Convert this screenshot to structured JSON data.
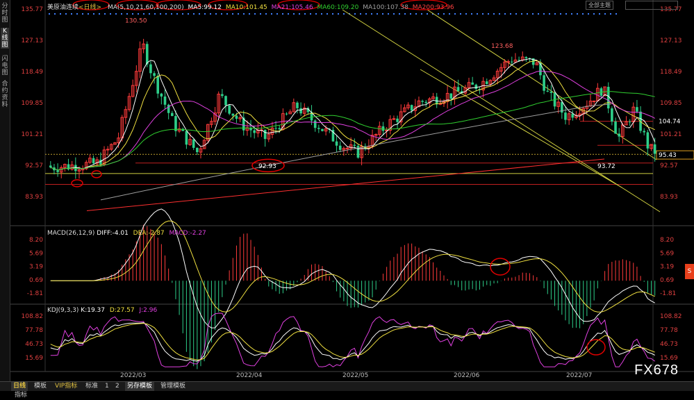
{
  "sidebar": {
    "tabs": [
      "分时图",
      "K线图",
      "闪电图",
      "合约资料"
    ],
    "active": 1
  },
  "main_chart": {
    "legend": {
      "symbol": "美原油连续",
      "period": "<日线>",
      "ma_params": "MA(5,10,21,60,100,200)",
      "ma5": "MA5:99.12",
      "ma10": "MA10:101.45",
      "ma21": "MA21:105.46",
      "ma60": "MA60:109.20",
      "ma100": "MA100:107.38",
      "ma200": "MA200:93.96"
    },
    "y_ticks": [
      "135.77",
      "127.13",
      "118.49",
      "109.85",
      "101.21",
      "92.57",
      "83.93"
    ],
    "annotations": {
      "high1": "130.50",
      "high2": "123.68",
      "low1": "92.93",
      "low2": "93.72",
      "level_104": "104.74",
      "price_box": "95.43",
      "right_92": "92.57"
    },
    "top_control": "全部主题"
  },
  "macd": {
    "title": "MACD(26,12,9)",
    "diff": "DIFF:-4.01",
    "dea": "DEA:-2.87",
    "macd": "MACD:-2.27",
    "y_ticks": [
      "8.20",
      "5.69",
      "3.19",
      "0.69",
      "-1.81"
    ]
  },
  "kdj": {
    "title": "KDJ(9,3,3)",
    "k": "K:19.37",
    "d": "D:27.57",
    "j": "J:2.96",
    "y_ticks": [
      "108.82",
      "77.78",
      "46.73",
      "15.69"
    ]
  },
  "x_axis": [
    "2022/03",
    "2022/04",
    "2022/05",
    "2022/06",
    "2022/07"
  ],
  "bottom_tabs": [
    "日线",
    "指标",
    "模板",
    "VIP指标",
    "标准",
    "1",
    "2",
    "另存模板",
    "管理模板"
  ],
  "watermark": "FX678",
  "colors": {
    "up": "#ff3b3b",
    "down": "#2ecf8a",
    "ma5": "#ffffff",
    "ma10": "#f0e040",
    "ma21": "#e040e0",
    "ma60": "#30d030",
    "ma100": "#a0a0a0",
    "ma200": "#ff3030",
    "circle": "#e00000"
  }
}
